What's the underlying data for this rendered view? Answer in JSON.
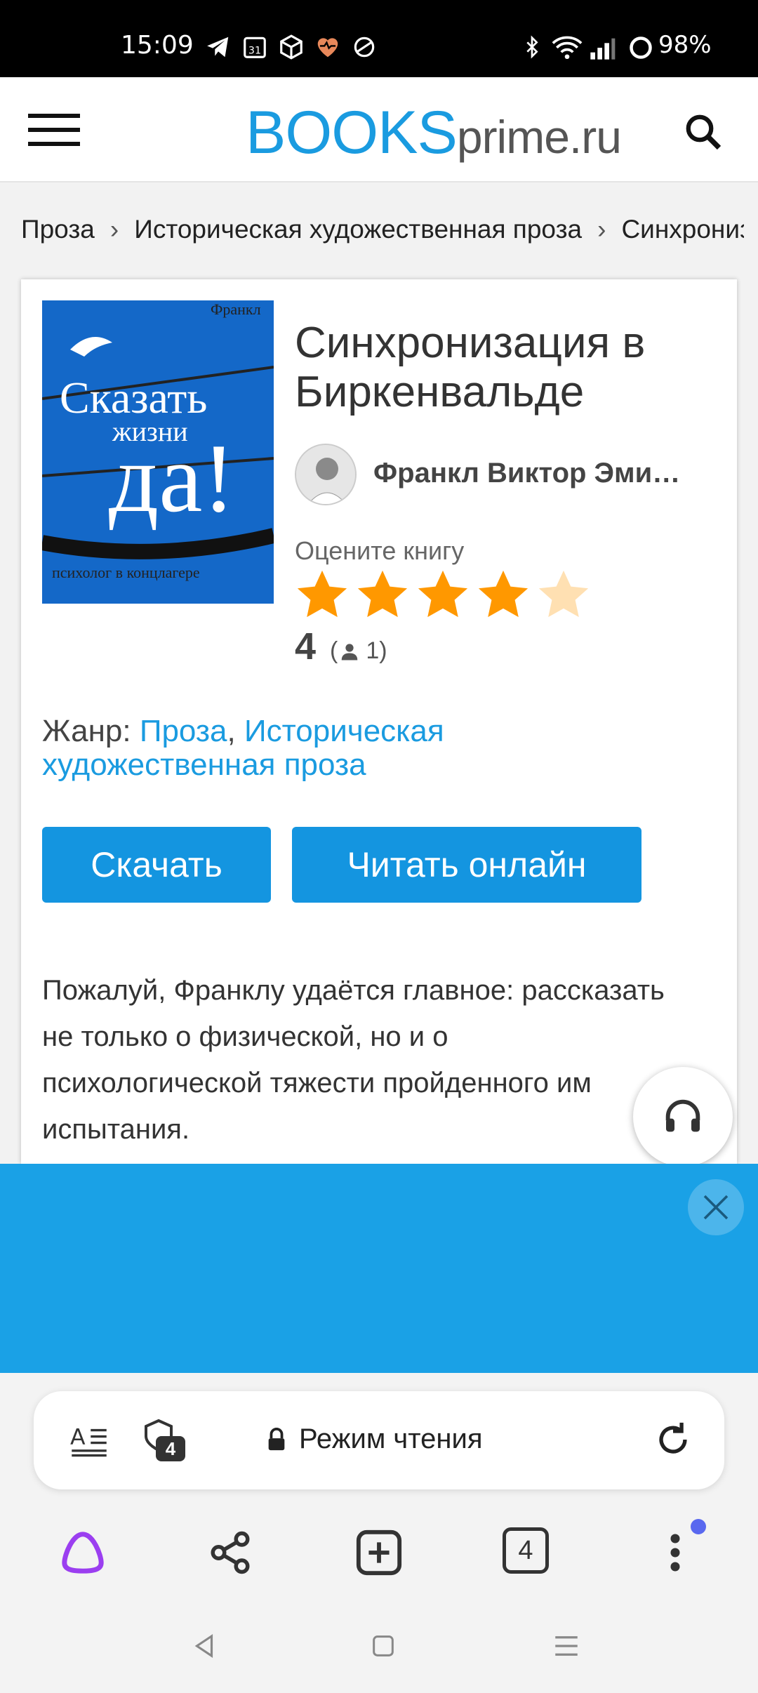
{
  "status_bar": {
    "time": "15:09",
    "battery": "98%"
  },
  "header": {
    "logo_main": "BOOKS",
    "logo_domain": "prime.ru"
  },
  "breadcrumb": [
    "Проза",
    "Историческая художественная проза",
    "Синхронизация в Биркенвальде"
  ],
  "breadcrumb_sep": "›",
  "book": {
    "title": "Синхронизация в Биркенвальде",
    "author": "Франкл Виктор Эмиль",
    "rate_label": "Оцените книгу",
    "rating": 4,
    "rating_max": 5,
    "rating_display": "4",
    "votes": "1",
    "genre_label": "Жанр: ",
    "genres": [
      "Проза",
      "Историческая художественная проза"
    ],
    "genre_sep": ", ",
    "cover": {
      "author": "Франкл",
      "line1": "Сказать",
      "line2": "жизни",
      "line3": "да!",
      "subtitle": "психолог в концлагере"
    },
    "description": "Пожалуй, Франклу удаётся главное: рассказать не только о физической, но и о психологической тяжести пройденного им испытания."
  },
  "buttons": {
    "download": "Скачать",
    "read_online": "Читать онлайн"
  },
  "browser": {
    "reader_mode": "Режим чтения",
    "shield_count": "4",
    "tabs_count": "4"
  },
  "colors": {
    "accent": "#1a9be0",
    "button": "#1495e0",
    "star": "#ff9800",
    "star_empty": "#ffe0b2",
    "ad": "#1aa1e6"
  }
}
